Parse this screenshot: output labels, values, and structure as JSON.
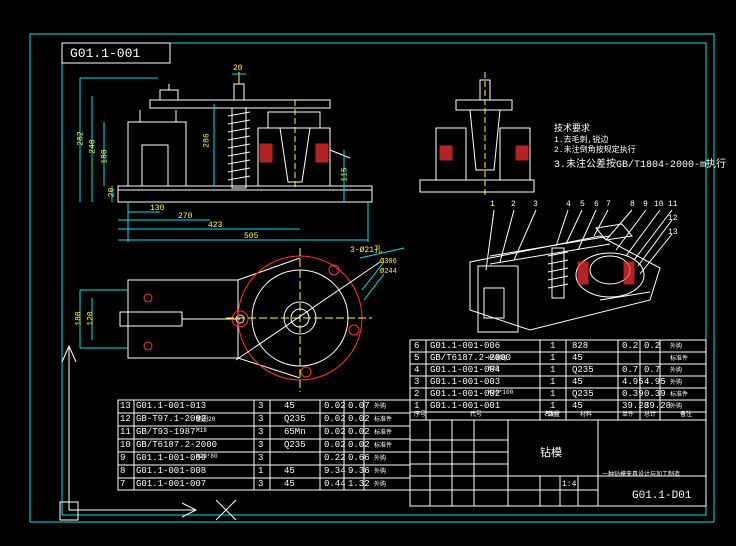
{
  "drawing_number": "G01.1-001",
  "title_block": {
    "name": "钻模",
    "subtitle": "一种钻模夹具设计与加工制造",
    "scale": "1:4",
    "sheet_number": "G01.1-D01"
  },
  "tech_requirements": {
    "heading": "技术要求",
    "items": [
      "1.去毛刺,锐边",
      "2.未注倒角按规定执行",
      "3.未注公差按GB/T1804-2000-m执行"
    ]
  },
  "dimensions": {
    "front_top": "20",
    "h_282": "282",
    "h_240": "240",
    "h_180": "180",
    "h_286": "286",
    "h_20": "20",
    "h_115": "115",
    "w_130": "130",
    "w_270": "270",
    "w_423": "423",
    "w_505": "505",
    "plan_180": "180",
    "plan_120": "120",
    "plan_holes": "3-Ø21孔",
    "plan_d306": "Ø306",
    "plan_d244": "Ø244"
  },
  "balloons": [
    "1",
    "2",
    "3",
    "4",
    "5",
    "6",
    "7",
    "8",
    "9",
    "10",
    "11",
    "12",
    "13"
  ],
  "bom_right": [
    {
      "no": "6",
      "code": "G01.1-001-006",
      "name": "",
      "qty": "1",
      "material": "828",
      "unit": "0.2",
      "total": "0.2",
      "remark": "外购"
    },
    {
      "no": "5",
      "code": "GB/T6187.2-2000",
      "name": "M5螺母",
      "qty": "1",
      "material": "45",
      "unit": "",
      "total": "",
      "remark": "标准件"
    },
    {
      "no": "4",
      "code": "G01.1-001-004",
      "name": "M20",
      "qty": "1",
      "material": "Q235",
      "unit": "0.7",
      "total": "0.7",
      "remark": "外购"
    },
    {
      "no": "3",
      "code": "G01.1-001-003",
      "name": "",
      "qty": "1",
      "material": "45",
      "unit": "4.95",
      "total": "4.95",
      "remark": "外购"
    },
    {
      "no": "2",
      "code": "G01.1-001-002",
      "name": "M20*100",
      "qty": "1",
      "material": "Q235",
      "unit": "0.39",
      "total": "0.39",
      "remark": "标准件"
    },
    {
      "no": "1",
      "code": "G01.1-001-001",
      "name": "",
      "qty": "1",
      "material": "45",
      "unit": "39.28",
      "total": "39.28",
      "remark": "外购"
    }
  ],
  "bom_right_header": [
    "序号",
    "代号",
    "名称",
    "数量",
    "材料",
    "单件",
    "总计",
    "备注"
  ],
  "bom_left": [
    {
      "no": "13",
      "code": "G01.1-001-013",
      "name": "",
      "qty": "3",
      "material": "45",
      "unit": "0.02",
      "total": "0.07",
      "remark": "外购"
    },
    {
      "no": "12",
      "code": "GB-T97.1-2002",
      "name": "垫圈20",
      "qty": "3",
      "material": "Q235",
      "unit": "0.02",
      "total": "0.02",
      "remark": "标准件"
    },
    {
      "no": "11",
      "code": "GB/T93-1987",
      "name": "M18",
      "qty": "3",
      "material": "65Mn",
      "unit": "0.02",
      "total": "0.02",
      "remark": "标准件"
    },
    {
      "no": "10",
      "code": "GB/T6187.2-2000",
      "name": "",
      "qty": "3",
      "material": "Q235",
      "unit": "0.02",
      "total": "0.02",
      "remark": "标准件"
    },
    {
      "no": "9",
      "code": "G01.1-001-009",
      "name": "M20*80",
      "qty": "3",
      "material": "",
      "unit": "0.22",
      "total": "0.66",
      "remark": "外购"
    },
    {
      "no": "8",
      "code": "G01.1-001-008",
      "name": "",
      "qty": "1",
      "material": "45",
      "unit": "9.34",
      "total": "9.36",
      "remark": "外购"
    },
    {
      "no": "7",
      "code": "G01.1-001-007",
      "name": "",
      "qty": "3",
      "material": "45",
      "unit": "0.44",
      "total": "1.32",
      "remark": "外购"
    }
  ]
}
